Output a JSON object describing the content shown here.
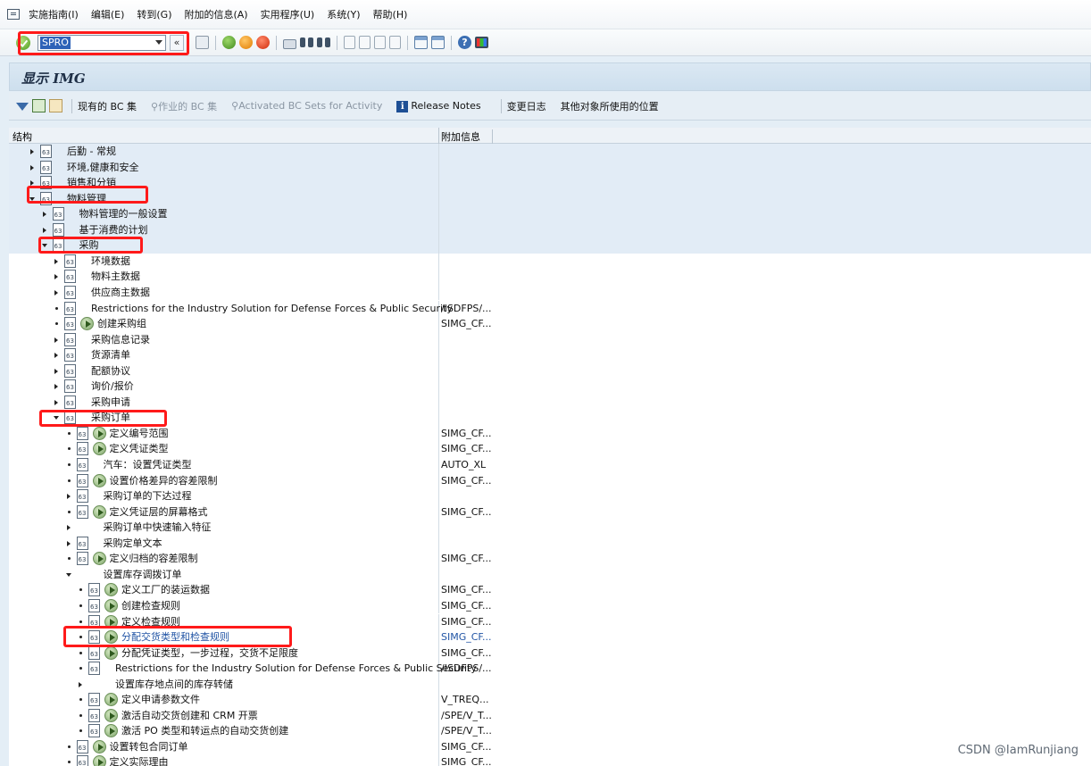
{
  "menu": [
    "实施指南(I)",
    "编辑(E)",
    "转到(G)",
    "附加的信息(A)",
    "实用程序(U)",
    "系统(Y)",
    "帮助(H)"
  ],
  "toolbar": {
    "command": "SPRO",
    "history_symbol": "«"
  },
  "title": "显示 IMG",
  "app_toolbar": {
    "existing_bc_sets": "现有的 BC 集",
    "bc_sets_activity": "作业的 BC 集",
    "activated_bc_sets": "Activated BC Sets for Activity",
    "release_notes": "Release Notes",
    "change_log": "变更日志",
    "where_used": "其他对象所使用的位置"
  },
  "tree": {
    "col_structure": "结构",
    "col_additional_info": "附加信息",
    "rows": [
      {
        "level": 0,
        "exp": "right",
        "doc": true,
        "exec": false,
        "label": "后勤 - 常规",
        "info": "",
        "hl": true
      },
      {
        "level": 0,
        "exp": "right",
        "doc": true,
        "exec": false,
        "label": "环境,健康和安全",
        "info": "",
        "hl": true
      },
      {
        "level": 0,
        "exp": "right",
        "doc": true,
        "exec": false,
        "label": "销售和分销",
        "info": "",
        "hl": true
      },
      {
        "level": 0,
        "exp": "down",
        "doc": true,
        "exec": false,
        "label": "物料管理",
        "info": "",
        "hl": true
      },
      {
        "level": 1,
        "exp": "right",
        "doc": true,
        "exec": false,
        "label": "物料管理的一般设置",
        "info": "",
        "hl": true
      },
      {
        "level": 1,
        "exp": "right",
        "doc": true,
        "exec": false,
        "label": "基于消费的计划",
        "info": "",
        "hl": true
      },
      {
        "level": 1,
        "exp": "down",
        "doc": true,
        "exec": false,
        "label": "采购",
        "info": "",
        "hl": true
      },
      {
        "level": 2,
        "exp": "right",
        "doc": true,
        "exec": false,
        "label": "环境数据",
        "info": "",
        "hl": false
      },
      {
        "level": 2,
        "exp": "right",
        "doc": true,
        "exec": false,
        "label": "物料主数据",
        "info": "",
        "hl": false
      },
      {
        "level": 2,
        "exp": "right",
        "doc": true,
        "exec": false,
        "label": "供应商主数据",
        "info": "",
        "hl": false
      },
      {
        "level": 2,
        "exp": "dot",
        "doc": true,
        "exec": false,
        "label": "Restrictions for the Industry Solution for Defense Forces & Public Security",
        "info": "/ISDFPS/...",
        "hl": false
      },
      {
        "level": 2,
        "exp": "dot",
        "doc": true,
        "exec": true,
        "label": "创建采购组",
        "info": "SIMG_CF...",
        "hl": false
      },
      {
        "level": 2,
        "exp": "right",
        "doc": true,
        "exec": false,
        "label": "采购信息记录",
        "info": "",
        "hl": false
      },
      {
        "level": 2,
        "exp": "right",
        "doc": true,
        "exec": false,
        "label": "货源清单",
        "info": "",
        "hl": false
      },
      {
        "level": 2,
        "exp": "right",
        "doc": true,
        "exec": false,
        "label": "配额协议",
        "info": "",
        "hl": false
      },
      {
        "level": 2,
        "exp": "right",
        "doc": true,
        "exec": false,
        "label": "询价/报价",
        "info": "",
        "hl": false
      },
      {
        "level": 2,
        "exp": "right",
        "doc": true,
        "exec": false,
        "label": "采购申请",
        "info": "",
        "hl": false
      },
      {
        "level": 2,
        "exp": "down",
        "doc": true,
        "exec": false,
        "label": "采购订单",
        "info": "",
        "hl": false
      },
      {
        "level": 3,
        "exp": "dot",
        "doc": true,
        "exec": true,
        "label": "定义编号范围",
        "info": "SIMG_CF...",
        "hl": false
      },
      {
        "level": 3,
        "exp": "dot",
        "doc": true,
        "exec": true,
        "label": "定义凭证类型",
        "info": "SIMG_CF...",
        "hl": false
      },
      {
        "level": 3,
        "exp": "dot",
        "doc": true,
        "exec": false,
        "label": "汽车：设置凭证类型",
        "info": "AUTO_XL",
        "hl": false
      },
      {
        "level": 3,
        "exp": "dot",
        "doc": true,
        "exec": true,
        "label": "设置价格差异的容差限制",
        "info": "SIMG_CF...",
        "hl": false
      },
      {
        "level": 3,
        "exp": "right",
        "doc": true,
        "exec": false,
        "label": "采购订单的下达过程",
        "info": "",
        "hl": false
      },
      {
        "level": 3,
        "exp": "dot",
        "doc": true,
        "exec": true,
        "label": "定义凭证层的屏幕格式",
        "info": "SIMG_CF...",
        "hl": false
      },
      {
        "level": 3,
        "exp": "right",
        "doc": false,
        "exec": false,
        "label": "采购订单中快速输入特征",
        "info": "",
        "hl": false
      },
      {
        "level": 3,
        "exp": "right",
        "doc": true,
        "exec": false,
        "label": "采购定单文本",
        "info": "",
        "hl": false
      },
      {
        "level": 3,
        "exp": "dot",
        "doc": true,
        "exec": true,
        "label": "定义归档的容差限制",
        "info": "SIMG_CF...",
        "hl": false
      },
      {
        "level": 3,
        "exp": "down",
        "doc": false,
        "exec": false,
        "label": "设置库存调拨订单",
        "info": "",
        "hl": false
      },
      {
        "level": 4,
        "exp": "dot",
        "doc": true,
        "exec": true,
        "label": "定义工厂的装运数据",
        "info": "SIMG_CF...",
        "hl": false
      },
      {
        "level": 4,
        "exp": "dot",
        "doc": true,
        "exec": true,
        "label": "创建检查规则",
        "info": "SIMG_CF...",
        "hl": false
      },
      {
        "level": 4,
        "exp": "dot",
        "doc": true,
        "exec": true,
        "label": "定义检查规则",
        "info": "SIMG_CF...",
        "hl": false
      },
      {
        "level": 4,
        "exp": "dot",
        "doc": true,
        "exec": true,
        "label": "分配交货类型和检查规则",
        "info": "SIMG_CF...",
        "hl": false,
        "link": true
      },
      {
        "level": 4,
        "exp": "dot",
        "doc": true,
        "exec": true,
        "label": "分配凭证类型，一步过程，交货不足限度",
        "info": "SIMG_CF...",
        "hl": false
      },
      {
        "level": 4,
        "exp": "dot",
        "doc": true,
        "exec": false,
        "label": "Restrictions for the Industry Solution for Defense Forces & Public Security",
        "info": "/ISDFPS/...",
        "hl": false
      },
      {
        "level": 4,
        "exp": "right",
        "doc": false,
        "exec": false,
        "label": "设置库存地点间的库存转储",
        "info": "",
        "hl": false
      },
      {
        "level": 4,
        "exp": "dot",
        "doc": true,
        "exec": true,
        "label": "定义申请参数文件",
        "info": "V_TREQ...",
        "hl": false
      },
      {
        "level": 4,
        "exp": "dot",
        "doc": true,
        "exec": true,
        "label": "激活自动交货创建和 CRM 开票",
        "info": "/SPE/V_T...",
        "hl": false
      },
      {
        "level": 4,
        "exp": "dot",
        "doc": true,
        "exec": true,
        "label": "激活 PO 类型和转运点的自动交货创建",
        "info": "/SPE/V_T...",
        "hl": false
      },
      {
        "level": 3,
        "exp": "dot",
        "doc": true,
        "exec": true,
        "label": "设置转包合同订单",
        "info": "SIMG_CF...",
        "hl": false
      },
      {
        "level": 3,
        "exp": "dot",
        "doc": true,
        "exec": true,
        "label": "定义实际理由",
        "info": "SIMG_CF...",
        "hl": false
      }
    ]
  },
  "watermark": "CSDN @IamRunjiang"
}
